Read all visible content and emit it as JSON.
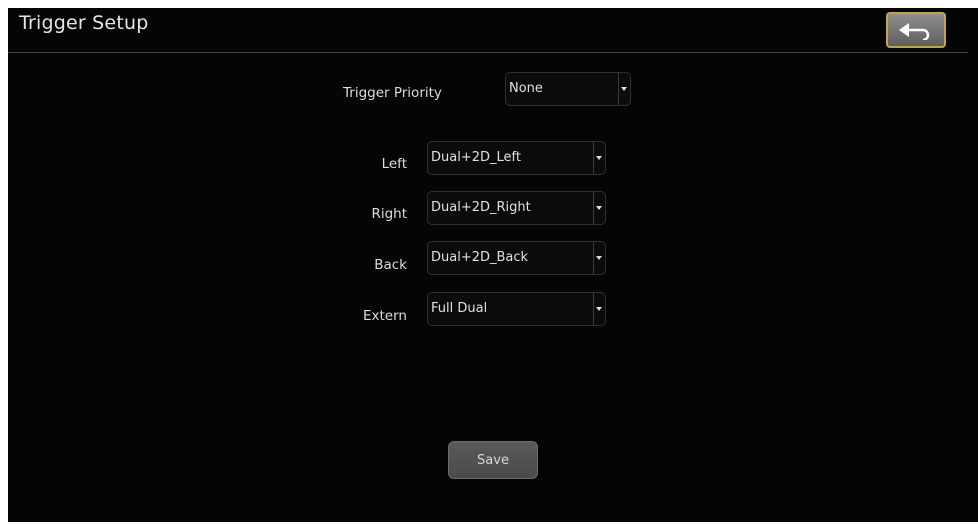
{
  "header": {
    "title": "Trigger Setup",
    "back_icon": "back-arrow-icon"
  },
  "trigger_priority": {
    "label": "Trigger Priority",
    "value": "None"
  },
  "triggers": [
    {
      "label": "Left",
      "value": "Dual+2D_Left"
    },
    {
      "label": "Right",
      "value": "Dual+2D_Right"
    },
    {
      "label": "Back",
      "value": "Dual+2D_Back"
    },
    {
      "label": "Extern",
      "value": "Full Dual"
    }
  ],
  "save_label": "Save",
  "colors": {
    "background": "#050505",
    "accent_border": "#c5a24c",
    "text": "#e0e0e0"
  }
}
